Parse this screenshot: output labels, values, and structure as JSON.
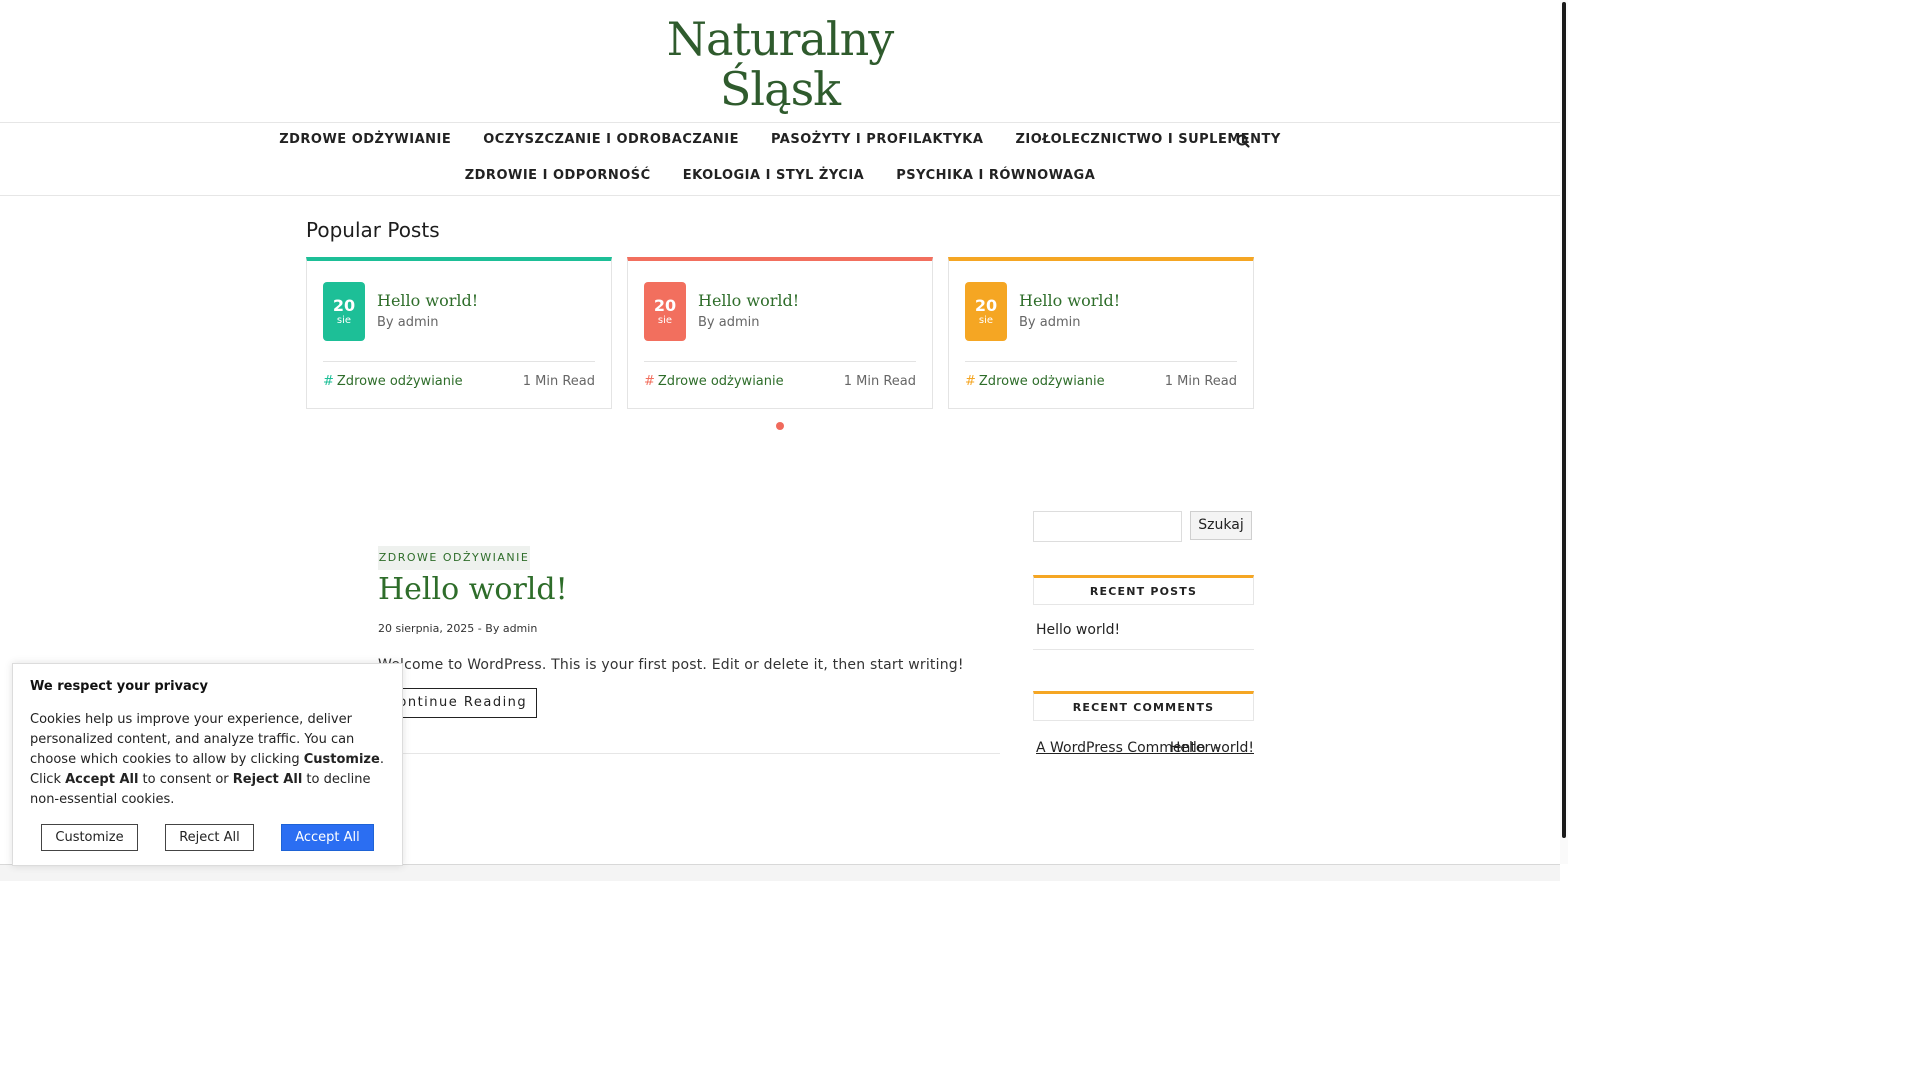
{
  "site": {
    "logo_line1": "Naturalny",
    "logo_line2": "Śląsk"
  },
  "nav": {
    "row1": [
      "ZDROWE ODŻYWIANIE",
      "OCZYSZCZANIE I ODROBACZANIE",
      "PASOŻYTY I PROFILAKTYKA",
      "ZIOŁOLECZNICTWO I SUPLEMENTY"
    ],
    "row2": [
      "ZDROWIE I ODPORNOŚĆ",
      "EKOLOGIA I STYL ŻYCIA",
      "PSYCHIKA I RÓWNOWAGA"
    ]
  },
  "popular": {
    "title": "Popular Posts",
    "cards": [
      {
        "day": "20",
        "month": "sie",
        "title": "Hello world!",
        "by": "By admin",
        "category": "Zdrowe odżywianie",
        "read": "1 Min Read",
        "color": "#1dbf97"
      },
      {
        "day": "20",
        "month": "sie",
        "title": "Hello world!",
        "by": "By admin",
        "category": "Zdrowe odżywianie",
        "read": "1 Min Read",
        "color": "#f26f5e"
      },
      {
        "day": "20",
        "month": "sie",
        "title": "Hello world!",
        "by": "By admin",
        "category": "Zdrowe odżywianie",
        "read": "1 Min Read",
        "color": "#f5a623"
      }
    ]
  },
  "post": {
    "category": "ZDROWE ODŻYWIANIE",
    "title": "Hello world!",
    "meta": "20 sierpnia, 2025 - By admin",
    "excerpt": "Welcome to WordPress. This is your first post. Edit or delete it, then start writing!",
    "read_more": "Continue Reading"
  },
  "sidebar": {
    "search_button": "Szukaj",
    "recent_posts_title": "RECENT POSTS",
    "recent_posts": [
      "Hello world!"
    ],
    "recent_comments_title": "RECENT COMMENTS",
    "comment_author": "A WordPress Commenter",
    "comment_separator": "-",
    "comment_post": "Hello world!"
  },
  "cookie": {
    "title": "We respect your privacy",
    "body_1": "Cookies help us improve your experience, deliver personalized content, and analyze traffic. You can choose which cookies to allow by clicking ",
    "customize_word": "Customize",
    "body_2": ". Click ",
    "accept_word": "Accept All",
    "body_3": " to consent or ",
    "reject_word": "Reject All",
    "body_4": " to decline non-essential cookies.",
    "btn_customize": "Customize",
    "btn_reject": "Reject All",
    "btn_accept": "Accept All"
  },
  "colors": {
    "brand_green": "#2e6d2a",
    "accent_teal": "#1dbf97",
    "accent_coral": "#f26f5e",
    "accent_orange": "#f5a623",
    "accept_blue": "#2b6ef2"
  }
}
